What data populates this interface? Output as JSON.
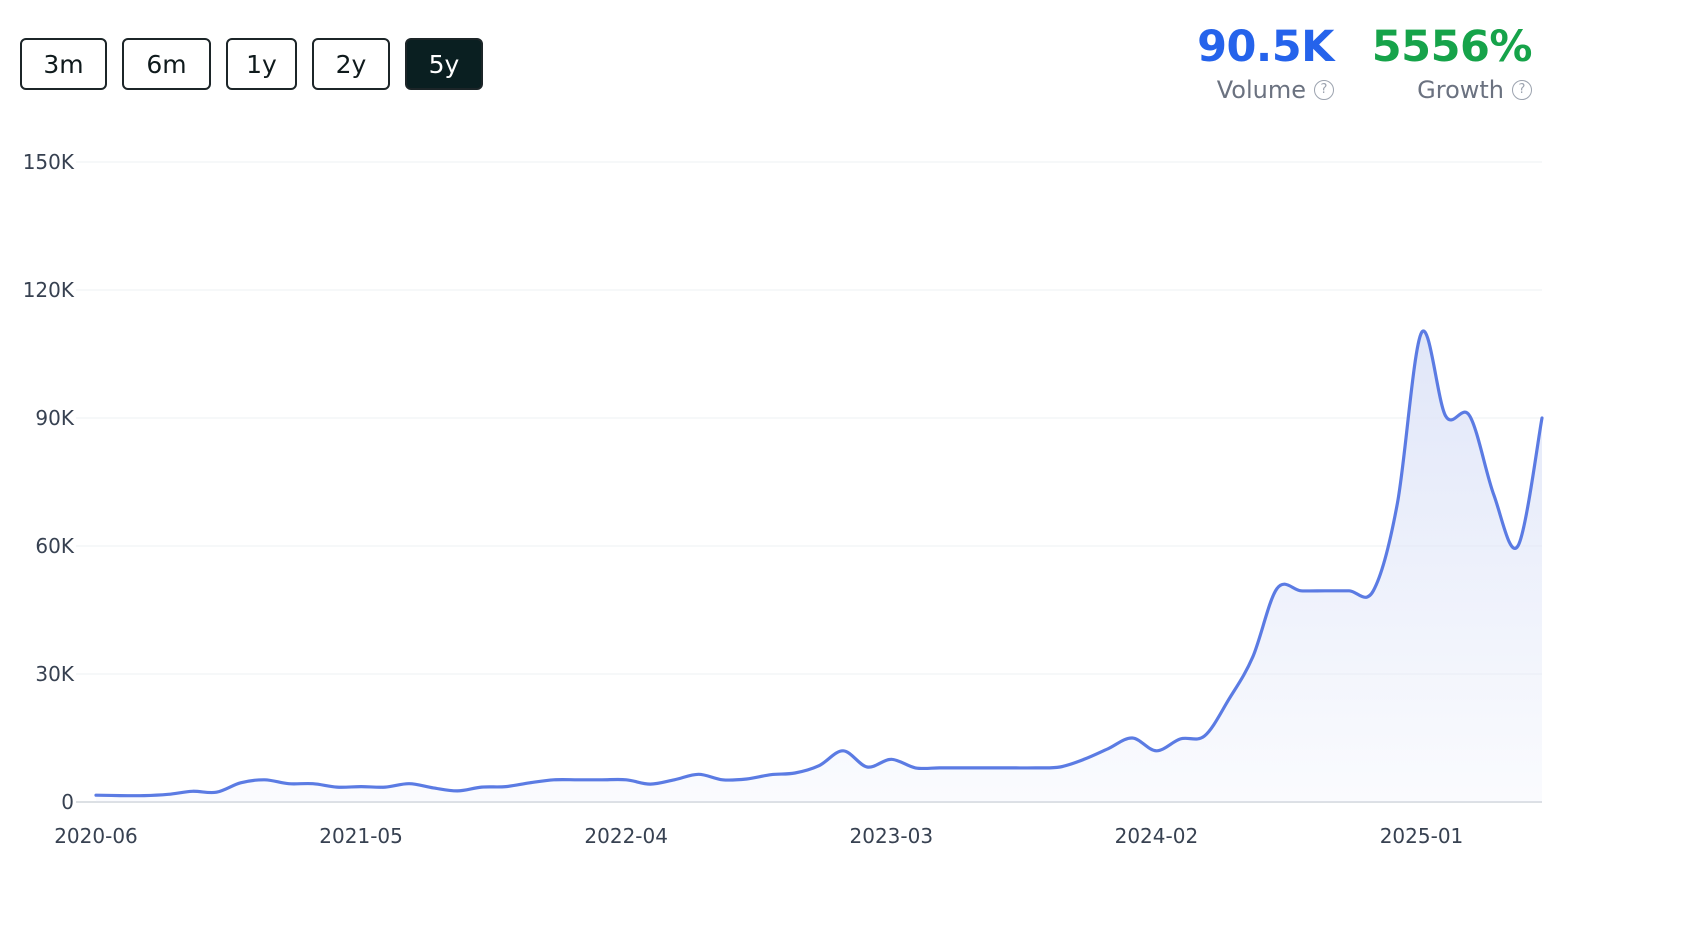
{
  "range_buttons": [
    {
      "label": "3m",
      "active": false
    },
    {
      "label": "6m",
      "active": false
    },
    {
      "label": "1y",
      "active": false
    },
    {
      "label": "2y",
      "active": false
    },
    {
      "label": "5y",
      "active": true
    }
  ],
  "stats": {
    "volume": {
      "value": "90.5K",
      "label": "Volume",
      "color": "#2563eb"
    },
    "growth": {
      "value": "5556%",
      "label": "Growth",
      "color": "#16a34a"
    }
  },
  "help_icon": "question-circle-icon",
  "chart_data": {
    "type": "area",
    "title": "",
    "xlabel": "",
    "ylabel": "",
    "ylim": [
      0,
      150000
    ],
    "y_ticks": [
      0,
      30000,
      60000,
      90000,
      120000,
      150000
    ],
    "y_tick_labels": [
      "0",
      "30K",
      "60K",
      "90K",
      "120K",
      "150K"
    ],
    "x_tick_labels": [
      "2020-06",
      "2021-05",
      "2022-04",
      "2023-03",
      "2024-02",
      "2025-01"
    ],
    "grid": true,
    "line_color": "#5b7be3",
    "fill_color": "#dfe5f8",
    "series": [
      {
        "x": [
          "2020-06",
          "2020-07",
          "2020-08",
          "2020-09",
          "2020-10",
          "2020-11",
          "2020-12",
          "2021-01",
          "2021-02",
          "2021-03",
          "2021-04",
          "2021-05",
          "2021-06",
          "2021-07",
          "2021-08",
          "2021-09",
          "2021-10",
          "2021-11",
          "2021-12",
          "2022-01",
          "2022-02",
          "2022-03",
          "2022-04",
          "2022-05",
          "2022-06",
          "2022-07",
          "2022-08",
          "2022-09",
          "2022-10",
          "2022-11",
          "2022-12",
          "2023-01",
          "2023-02",
          "2023-03",
          "2023-04",
          "2023-05",
          "2023-06",
          "2023-07",
          "2023-08",
          "2023-09",
          "2023-10",
          "2023-11",
          "2023-12",
          "2024-01",
          "2024-02",
          "2024-03",
          "2024-04",
          "2024-05",
          "2024-06",
          "2024-07",
          "2024-08",
          "2024-09",
          "2024-10",
          "2024-11",
          "2024-12",
          "2025-01",
          "2025-02",
          "2025-03",
          "2025-04",
          "2025-05",
          "2025-06"
        ],
        "values": [
          1600,
          1500,
          1500,
          1800,
          2500,
          2300,
          4500,
          5200,
          4300,
          4300,
          3500,
          3600,
          3500,
          4300,
          3300,
          2600,
          3500,
          3600,
          4500,
          5200,
          5200,
          5200,
          5200,
          4200,
          5200,
          6500,
          5200,
          5400,
          6400,
          6800,
          8500,
          12000,
          8200,
          10000,
          8000,
          8000,
          8000,
          8000,
          8000,
          8000,
          8200,
          10000,
          12500,
          15000,
          12000,
          14800,
          15500,
          24000,
          34000,
          50000,
          49500,
          49500,
          49500,
          49500,
          70000,
          110000,
          90500,
          90500,
          72000,
          60000,
          90000
        ]
      }
    ]
  }
}
